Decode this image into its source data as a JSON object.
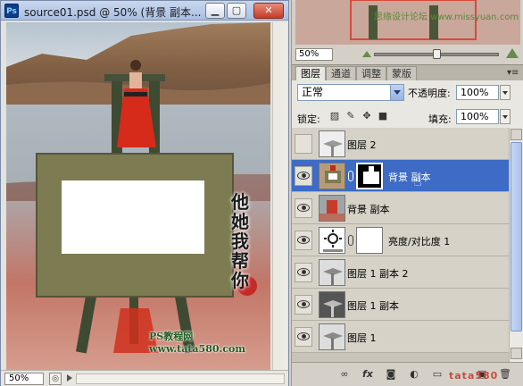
{
  "document_window": {
    "app_icon_label": "Ps",
    "title": "source01.psd @ 50% (背景 副本...",
    "minimize_glyph": "▁",
    "maximize_glyph": "▢",
    "close_glyph": "✕",
    "zoom": "50%",
    "canvas_calligraphy": "他她我帮你",
    "canvas_watermark": "PS教程网 www.tata580.com"
  },
  "navigator": {
    "zoom": "50%",
    "zoom_slider_level": 0.55,
    "watermark_text": "思缘设计论坛 www.missyuan.com"
  },
  "panel_tabs": [
    {
      "label": "图层",
      "active": true
    },
    {
      "label": "通道",
      "active": false
    },
    {
      "label": "调整",
      "active": false
    },
    {
      "label": "蒙版",
      "active": false
    }
  ],
  "layers_panel": {
    "blend_mode": "正常",
    "opacity_label": "不透明度:",
    "opacity_value": "100%",
    "lock_label": "锁定:",
    "lock_icons": [
      "lock-transparent-icon",
      "lock-paint-icon",
      "lock-move-icon",
      "lock-all-icon"
    ],
    "fill_label": "填充:",
    "fill_value": "100%",
    "layers": [
      {
        "name": "图层 2",
        "visible": false,
        "selected": false,
        "has_mask": false
      },
      {
        "name": "背景 副本",
        "visible": true,
        "selected": true,
        "has_mask": true
      },
      {
        "name": "背景 副本",
        "visible": true,
        "selected": false,
        "has_mask": false
      },
      {
        "name": "亮度/对比度 1",
        "visible": true,
        "selected": false,
        "has_mask": true
      },
      {
        "name": "图层 1 副本 2",
        "visible": true,
        "selected": false,
        "has_mask": false
      },
      {
        "name": "图层 1 副本",
        "visible": true,
        "selected": false,
        "has_mask": false
      },
      {
        "name": "图层 1",
        "visible": true,
        "selected": false,
        "has_mask": false
      }
    ],
    "footer_icons": [
      "link-layers-icon",
      "fx-icon",
      "add-mask-icon",
      "adjustment-icon",
      "group-icon",
      "new-layer-icon",
      "delete-layer-icon"
    ],
    "footer_watermark": "tata580"
  },
  "colors": {
    "selection": "#3d6bc5",
    "panel_bg": "#d4d0c8",
    "title_gradient": "#a9bfe2"
  }
}
